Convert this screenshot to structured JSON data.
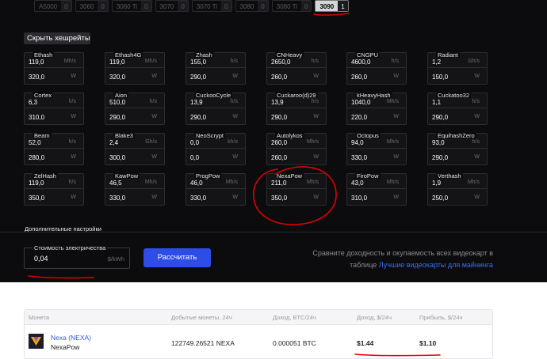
{
  "gpus": [
    {
      "name": "A5000",
      "count": "0",
      "active": false
    },
    {
      "name": "3060",
      "count": "0",
      "active": false
    },
    {
      "name": "3060 Ti",
      "count": "0",
      "active": false
    },
    {
      "name": "3070",
      "count": "0",
      "active": false
    },
    {
      "name": "3070 Ti",
      "count": "0",
      "active": false
    },
    {
      "name": "3080",
      "count": "0",
      "active": false
    },
    {
      "name": "3080 Ti",
      "count": "0",
      "active": false
    },
    {
      "name": "3090",
      "count": "1",
      "active": true
    }
  ],
  "hide_hashrates_label": "Скрыть хешрейты",
  "algorithms": [
    {
      "name": "Ethash",
      "hashrate": "119,0",
      "hash_unit": "Mh/s",
      "power": "320,0",
      "power_unit": "W"
    },
    {
      "name": "Ethash4G",
      "hashrate": "119,0",
      "hash_unit": "Mh/s",
      "power": "320,0",
      "power_unit": "W"
    },
    {
      "name": "Zhash",
      "hashrate": "155,0",
      "hash_unit": "h/s",
      "power": "290,0",
      "power_unit": "W"
    },
    {
      "name": "CNHeavy",
      "hashrate": "2650,0",
      "hash_unit": "h/s",
      "power": "260,0",
      "power_unit": "W"
    },
    {
      "name": "CNGPU",
      "hashrate": "4600,0",
      "hash_unit": "h/s",
      "power": "260,0",
      "power_unit": "W"
    },
    {
      "name": "Radiant",
      "hashrate": "1,2",
      "hash_unit": "Gh/s",
      "power": "150,0",
      "power_unit": "W"
    },
    {
      "name": "Cortex",
      "hashrate": "6,3",
      "hash_unit": "h/s",
      "power": "310,0",
      "power_unit": "W"
    },
    {
      "name": "Aion",
      "hashrate": "510,0",
      "hash_unit": "h/s",
      "power": "290,0",
      "power_unit": "W"
    },
    {
      "name": "CuckooCycle",
      "hashrate": "13,9",
      "hash_unit": "h/s",
      "power": "290,0",
      "power_unit": "W"
    },
    {
      "name": "Cuckaroo(d)29",
      "hashrate": "13,9",
      "hash_unit": "h/s",
      "power": "290,0",
      "power_unit": "W"
    },
    {
      "name": "kHeavyHash",
      "hashrate": "1040,0",
      "hash_unit": "Mh/s",
      "power": "220,0",
      "power_unit": "W"
    },
    {
      "name": "Cuckatoo32",
      "hashrate": "1,1",
      "hash_unit": "h/s",
      "power": "290,0",
      "power_unit": "W"
    },
    {
      "name": "Beam",
      "hashrate": "52,0",
      "hash_unit": "h/s",
      "power": "280,0",
      "power_unit": "W"
    },
    {
      "name": "Blake3",
      "hashrate": "2,4",
      "hash_unit": "Gh/s",
      "power": "300,0",
      "power_unit": "W"
    },
    {
      "name": "NeoScrypt",
      "hashrate": "0,0",
      "hash_unit": "kh/s",
      "power": "0,0",
      "power_unit": "W"
    },
    {
      "name": "Autolykos",
      "hashrate": "260,0",
      "hash_unit": "Mh/s",
      "power": "260,0",
      "power_unit": "W"
    },
    {
      "name": "Octopus",
      "hashrate": "94,0",
      "hash_unit": "Mh/s",
      "power": "330,0",
      "power_unit": "W"
    },
    {
      "name": "EquihashZero",
      "hashrate": "93,0",
      "hash_unit": "h/s",
      "power": "290,0",
      "power_unit": "W"
    },
    {
      "name": "ZelHash",
      "hashrate": "119,0",
      "hash_unit": "h/s",
      "power": "350,0",
      "power_unit": "W"
    },
    {
      "name": "KawPow",
      "hashrate": "46,5",
      "hash_unit": "Mh/s",
      "power": "330,0",
      "power_unit": "W"
    },
    {
      "name": "ProgPow",
      "hashrate": "46,0",
      "hash_unit": "Mh/s",
      "power": "330,0",
      "power_unit": "W"
    },
    {
      "name": "NexaPow",
      "hashrate": "211,0",
      "hash_unit": "Mh/s",
      "power": "350,0",
      "power_unit": "W"
    },
    {
      "name": "FiroPow",
      "hashrate": "43,0",
      "hash_unit": "Mh/s",
      "power": "310,0",
      "power_unit": "W"
    },
    {
      "name": "Verthash",
      "hashrate": "1,9",
      "hash_unit": "Mh/s",
      "power": "250,0",
      "power_unit": "W"
    }
  ],
  "additional_settings_label": "Дополнительные настройки",
  "electricity": {
    "label": "Стоимость электричества",
    "value": "0,04",
    "unit": "$/kWh"
  },
  "calculate_label": "Рассчитать",
  "compare": {
    "line1": "Сравните доходность и окупаемость всех видеокарт в",
    "line2_prefix": "таблице ",
    "link": "Лучшие видеокарты для майнинга"
  },
  "table": {
    "headers": [
      "Монета",
      "Добытые монеты, 24ч",
      "Доход, BTC/24ч",
      "Доход, $/24ч",
      "Прибыль, $/24ч"
    ],
    "rows": [
      {
        "coin": "Nexa (NEXA)",
        "algo": "NexaPow",
        "mined": "122749.26521 NEXA",
        "btc": "0.000051 BTC",
        "usd": "$1.44",
        "profit": "$1.10"
      }
    ]
  },
  "colors": {
    "accent": "#2e4de6",
    "link": "#3d6cf0",
    "annotation": "#e00000"
  }
}
